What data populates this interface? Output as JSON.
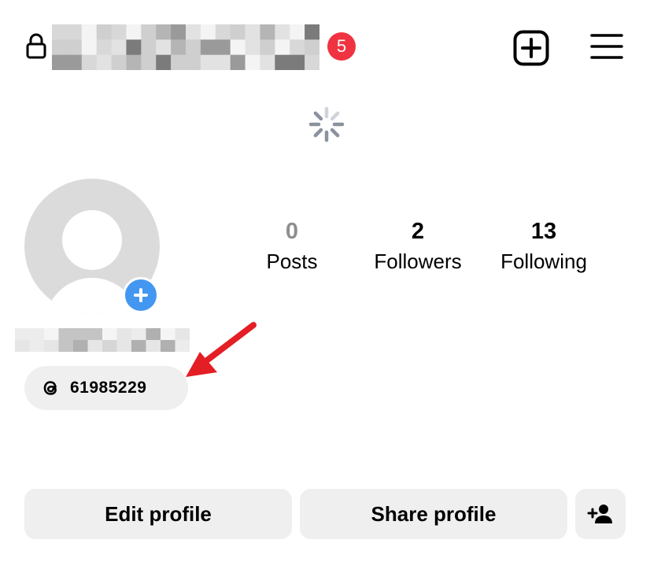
{
  "header": {
    "notification_count": "5",
    "lock_icon": "lock-icon",
    "new_post_icon": "plus-square-icon",
    "menu_icon": "hamburger-menu-icon"
  },
  "stats": [
    {
      "value": "0",
      "label": "Posts"
    },
    {
      "value": "2",
      "label": "Followers"
    },
    {
      "value": "13",
      "label": "Following"
    }
  ],
  "threads": {
    "icon": "threads-icon",
    "id": "61985229"
  },
  "actions": {
    "edit_label": "Edit profile",
    "share_label": "Share profile",
    "add_friend_icon": "person-add-icon"
  },
  "colors": {
    "badge": "#ef3340",
    "add_story": "#4497f0",
    "button_bg": "#efefef",
    "arrow": "#e41e25"
  }
}
